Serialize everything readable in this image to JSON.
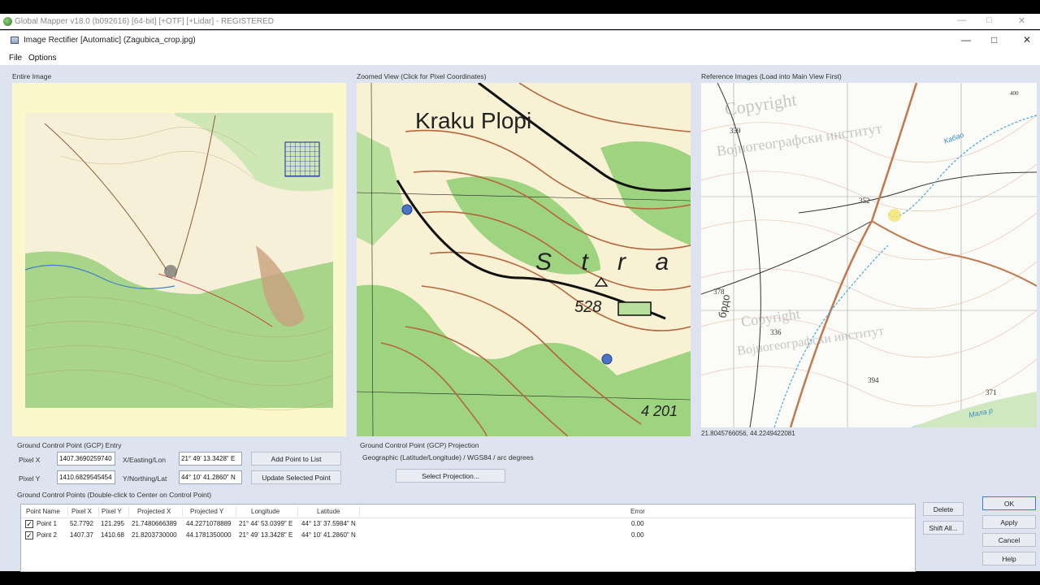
{
  "app_window": {
    "title": "Global Mapper v18.0 (b092616) [64-bit] [+OTF] [+Lidar] - REGISTERED"
  },
  "dialog": {
    "title": "Image Rectifier [Automatic] (Zagubica_crop.jpg)",
    "menu": [
      "File",
      "Options"
    ]
  },
  "panels": {
    "entire_image": "Entire Image",
    "zoomed_view": "Zoomed View (Click for Pixel Coordinates)",
    "reference": "Reference Images (Load into Main View First)"
  },
  "map_labels": {
    "zoom_title": "Kraku Plopi",
    "zoom_letters": "S t r a",
    "zoom_peak": "528",
    "zoom_corner": "4 201",
    "ref_elev": [
      "339",
      "352",
      "378",
      "336",
      "394",
      "371",
      "400"
    ],
    "ref_watermark_1": "Copyright",
    "ref_watermark_2": "Војногеографски институт",
    "ref_river": "Кабао",
    "ref_river2": "Мала р",
    "ref_side": "брдо"
  },
  "reference_coords": "21.8045766056, 44.2249422081",
  "gcp_entry": {
    "title": "Ground Control Point (GCP) Entry",
    "pixel_x_label": "Pixel X",
    "pixel_x_value": "1407.3690259740",
    "pixel_y_label": "Pixel Y",
    "pixel_y_value": "1410.6829545454",
    "x_label": "X/Easting/Lon",
    "x_value": "21° 49' 13.3428\" E",
    "y_label": "Y/Northing/Lat",
    "y_value": "44° 10' 41.2860\" N",
    "add_button": "Add Point to List",
    "update_button": "Update Selected Point"
  },
  "gcp_projection": {
    "title": "Ground Control Point (GCP) Projection",
    "value": "Geographic (Latitude/Longitude) / WGS84 / arc degrees",
    "select_button": "Select Projection..."
  },
  "gcp_points": {
    "title": "Ground Control Points (Double-click to Center on Control Point)",
    "columns": [
      "Point Name",
      "Pixel X",
      "Pixel Y",
      "Projected X",
      "Projected Y",
      "Longitude",
      "Latitude",
      "Error"
    ],
    "rows": [
      {
        "name": "Point 1",
        "px": "52.7792",
        "py": "121.295",
        "projx": "21.7480666389",
        "projy": "44.2271078889",
        "lon": "21° 44' 53.0399\" E",
        "lat": "44° 13' 37.5984\" N",
        "err": "0.00"
      },
      {
        "name": "Point 2",
        "px": "1407.37",
        "py": "1410.68",
        "projx": "21.8203730000",
        "projy": "44.1781350000",
        "lon": "21° 49' 13.3428\" E",
        "lat": "44° 10' 41.2860\" N",
        "err": "0.00"
      }
    ]
  },
  "side_buttons": {
    "delete": "Delete",
    "shift_all": "Shift All...",
    "ok": "OK",
    "apply": "Apply",
    "cancel": "Cancel",
    "help": "Help"
  },
  "colors": {
    "dialog_bg": "#dde4ef",
    "entire_bg": "#fdf8cc",
    "map_green": "#9ed37f",
    "map_paper": "#f8f1d4",
    "contour": "#b66a3a",
    "ok_border": "#3b7ddd"
  }
}
